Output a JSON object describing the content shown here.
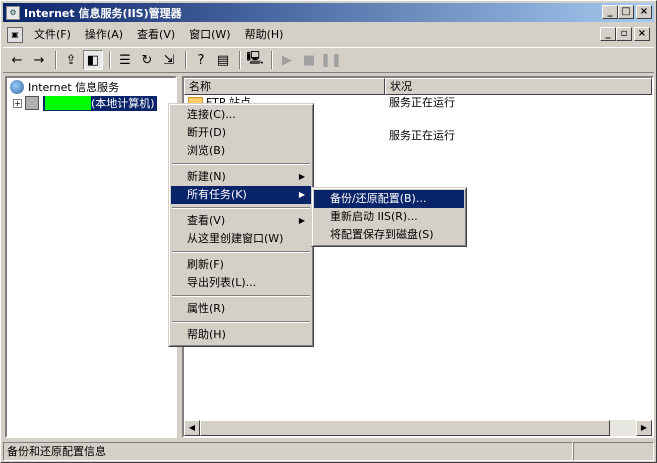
{
  "window": {
    "title": "Internet 信息服务(IIS)管理器"
  },
  "menubar": {
    "items": [
      "文件(F)",
      "操作(A)",
      "查看(V)",
      "窗口(W)",
      "帮助(H)"
    ]
  },
  "tree": {
    "root": "Internet 信息服务",
    "host_suffix": "(本地计算机)"
  },
  "list": {
    "columns": [
      "名称",
      "状况"
    ],
    "rows": [
      {
        "name": "FTP 站点",
        "status": "服务正在运行"
      },
      {
        "name": "",
        "status": "服务正在运行"
      }
    ]
  },
  "context_menu": {
    "items": [
      "连接(C)...",
      "断开(D)",
      "浏览(B)",
      "新建(N)",
      "所有任务(K)",
      "查看(V)",
      "从这里创建窗口(W)",
      "刷新(F)",
      "导出列表(L)...",
      "属性(R)",
      "帮助(H)"
    ]
  },
  "submenu": {
    "items": [
      "备份/还原配置(B)...",
      "重新启动 IIS(R)...",
      "将配置保存到磁盘(S)"
    ]
  },
  "statusbar": {
    "text": "备份和还原配置信息"
  },
  "colors": {
    "title_start": "#0a246a",
    "title_end": "#a6caf0",
    "highlight": "#0a246a",
    "redaction": "#00ff00"
  }
}
